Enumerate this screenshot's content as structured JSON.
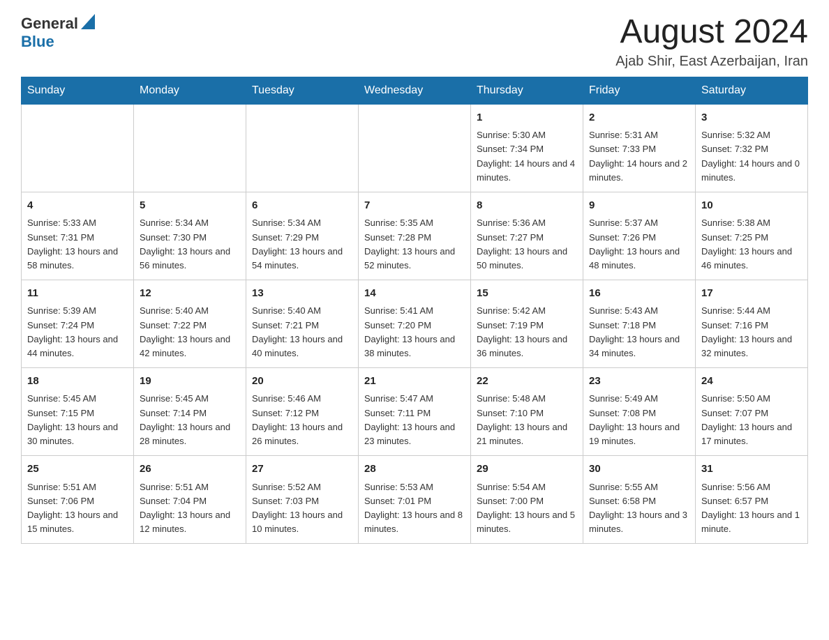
{
  "header": {
    "logo_general": "General",
    "logo_blue": "Blue",
    "month_title": "August 2024",
    "subtitle": "Ajab Shir, East Azerbaijan, Iran"
  },
  "weekdays": [
    "Sunday",
    "Monday",
    "Tuesday",
    "Wednesday",
    "Thursday",
    "Friday",
    "Saturday"
  ],
  "weeks": [
    [
      {
        "day": "",
        "sunrise": "",
        "sunset": "",
        "daylight": ""
      },
      {
        "day": "",
        "sunrise": "",
        "sunset": "",
        "daylight": ""
      },
      {
        "day": "",
        "sunrise": "",
        "sunset": "",
        "daylight": ""
      },
      {
        "day": "",
        "sunrise": "",
        "sunset": "",
        "daylight": ""
      },
      {
        "day": "1",
        "sunrise": "Sunrise: 5:30 AM",
        "sunset": "Sunset: 7:34 PM",
        "daylight": "Daylight: 14 hours and 4 minutes."
      },
      {
        "day": "2",
        "sunrise": "Sunrise: 5:31 AM",
        "sunset": "Sunset: 7:33 PM",
        "daylight": "Daylight: 14 hours and 2 minutes."
      },
      {
        "day": "3",
        "sunrise": "Sunrise: 5:32 AM",
        "sunset": "Sunset: 7:32 PM",
        "daylight": "Daylight: 14 hours and 0 minutes."
      }
    ],
    [
      {
        "day": "4",
        "sunrise": "Sunrise: 5:33 AM",
        "sunset": "Sunset: 7:31 PM",
        "daylight": "Daylight: 13 hours and 58 minutes."
      },
      {
        "day": "5",
        "sunrise": "Sunrise: 5:34 AM",
        "sunset": "Sunset: 7:30 PM",
        "daylight": "Daylight: 13 hours and 56 minutes."
      },
      {
        "day": "6",
        "sunrise": "Sunrise: 5:34 AM",
        "sunset": "Sunset: 7:29 PM",
        "daylight": "Daylight: 13 hours and 54 minutes."
      },
      {
        "day": "7",
        "sunrise": "Sunrise: 5:35 AM",
        "sunset": "Sunset: 7:28 PM",
        "daylight": "Daylight: 13 hours and 52 minutes."
      },
      {
        "day": "8",
        "sunrise": "Sunrise: 5:36 AM",
        "sunset": "Sunset: 7:27 PM",
        "daylight": "Daylight: 13 hours and 50 minutes."
      },
      {
        "day": "9",
        "sunrise": "Sunrise: 5:37 AM",
        "sunset": "Sunset: 7:26 PM",
        "daylight": "Daylight: 13 hours and 48 minutes."
      },
      {
        "day": "10",
        "sunrise": "Sunrise: 5:38 AM",
        "sunset": "Sunset: 7:25 PM",
        "daylight": "Daylight: 13 hours and 46 minutes."
      }
    ],
    [
      {
        "day": "11",
        "sunrise": "Sunrise: 5:39 AM",
        "sunset": "Sunset: 7:24 PM",
        "daylight": "Daylight: 13 hours and 44 minutes."
      },
      {
        "day": "12",
        "sunrise": "Sunrise: 5:40 AM",
        "sunset": "Sunset: 7:22 PM",
        "daylight": "Daylight: 13 hours and 42 minutes."
      },
      {
        "day": "13",
        "sunrise": "Sunrise: 5:40 AM",
        "sunset": "Sunset: 7:21 PM",
        "daylight": "Daylight: 13 hours and 40 minutes."
      },
      {
        "day": "14",
        "sunrise": "Sunrise: 5:41 AM",
        "sunset": "Sunset: 7:20 PM",
        "daylight": "Daylight: 13 hours and 38 minutes."
      },
      {
        "day": "15",
        "sunrise": "Sunrise: 5:42 AM",
        "sunset": "Sunset: 7:19 PM",
        "daylight": "Daylight: 13 hours and 36 minutes."
      },
      {
        "day": "16",
        "sunrise": "Sunrise: 5:43 AM",
        "sunset": "Sunset: 7:18 PM",
        "daylight": "Daylight: 13 hours and 34 minutes."
      },
      {
        "day": "17",
        "sunrise": "Sunrise: 5:44 AM",
        "sunset": "Sunset: 7:16 PM",
        "daylight": "Daylight: 13 hours and 32 minutes."
      }
    ],
    [
      {
        "day": "18",
        "sunrise": "Sunrise: 5:45 AM",
        "sunset": "Sunset: 7:15 PM",
        "daylight": "Daylight: 13 hours and 30 minutes."
      },
      {
        "day": "19",
        "sunrise": "Sunrise: 5:45 AM",
        "sunset": "Sunset: 7:14 PM",
        "daylight": "Daylight: 13 hours and 28 minutes."
      },
      {
        "day": "20",
        "sunrise": "Sunrise: 5:46 AM",
        "sunset": "Sunset: 7:12 PM",
        "daylight": "Daylight: 13 hours and 26 minutes."
      },
      {
        "day": "21",
        "sunrise": "Sunrise: 5:47 AM",
        "sunset": "Sunset: 7:11 PM",
        "daylight": "Daylight: 13 hours and 23 minutes."
      },
      {
        "day": "22",
        "sunrise": "Sunrise: 5:48 AM",
        "sunset": "Sunset: 7:10 PM",
        "daylight": "Daylight: 13 hours and 21 minutes."
      },
      {
        "day": "23",
        "sunrise": "Sunrise: 5:49 AM",
        "sunset": "Sunset: 7:08 PM",
        "daylight": "Daylight: 13 hours and 19 minutes."
      },
      {
        "day": "24",
        "sunrise": "Sunrise: 5:50 AM",
        "sunset": "Sunset: 7:07 PM",
        "daylight": "Daylight: 13 hours and 17 minutes."
      }
    ],
    [
      {
        "day": "25",
        "sunrise": "Sunrise: 5:51 AM",
        "sunset": "Sunset: 7:06 PM",
        "daylight": "Daylight: 13 hours and 15 minutes."
      },
      {
        "day": "26",
        "sunrise": "Sunrise: 5:51 AM",
        "sunset": "Sunset: 7:04 PM",
        "daylight": "Daylight: 13 hours and 12 minutes."
      },
      {
        "day": "27",
        "sunrise": "Sunrise: 5:52 AM",
        "sunset": "Sunset: 7:03 PM",
        "daylight": "Daylight: 13 hours and 10 minutes."
      },
      {
        "day": "28",
        "sunrise": "Sunrise: 5:53 AM",
        "sunset": "Sunset: 7:01 PM",
        "daylight": "Daylight: 13 hours and 8 minutes."
      },
      {
        "day": "29",
        "sunrise": "Sunrise: 5:54 AM",
        "sunset": "Sunset: 7:00 PM",
        "daylight": "Daylight: 13 hours and 5 minutes."
      },
      {
        "day": "30",
        "sunrise": "Sunrise: 5:55 AM",
        "sunset": "Sunset: 6:58 PM",
        "daylight": "Daylight: 13 hours and 3 minutes."
      },
      {
        "day": "31",
        "sunrise": "Sunrise: 5:56 AM",
        "sunset": "Sunset: 6:57 PM",
        "daylight": "Daylight: 13 hours and 1 minute."
      }
    ]
  ]
}
